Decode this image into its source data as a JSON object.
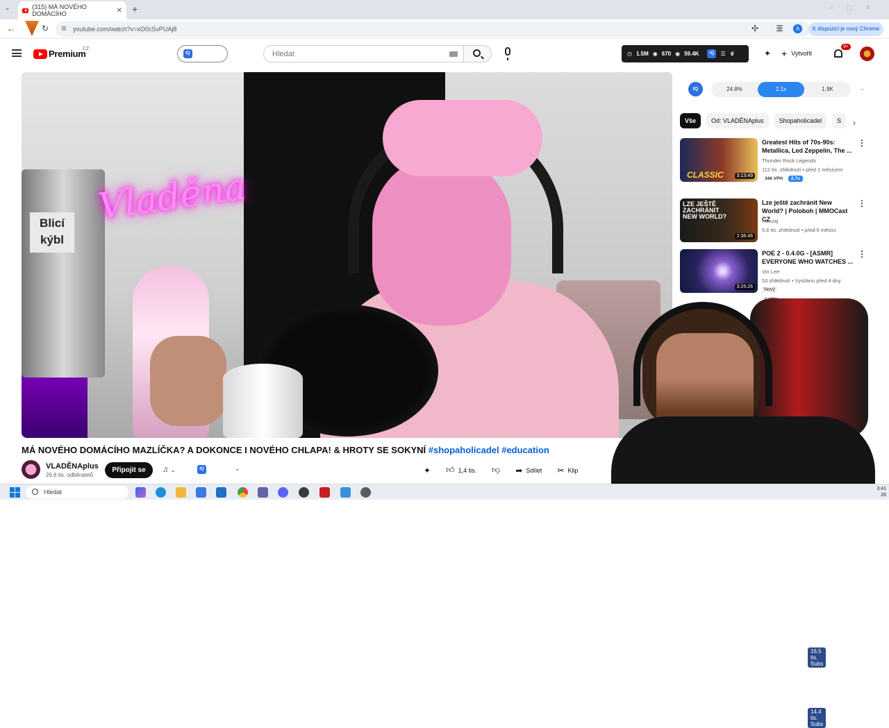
{
  "browser": {
    "tab_title": "(315) MÁ NOVÉHO DOMÁCÍHO",
    "tab_close": "✕",
    "new_tab": "+",
    "url": "youtube.com/watch?v=xO0cSvPUAj8",
    "chrome_notice": "K dispozici je nový Chrome",
    "profile_initial": "A"
  },
  "header": {
    "brand": "Premium",
    "region": "CZ",
    "search_placeholder": "Hledat",
    "stats": {
      "views": "1.5M",
      "viewers": "670",
      "likes": "59.4K",
      "iq": "IQ"
    },
    "create_label": "Vytvořit",
    "notifications": "9+"
  },
  "video": {
    "neon_text": "Vladěna",
    "bucket_text": "Blicí kýbl",
    "title_main": "MÁ NOVÉHO DOMÁCÍHO MAZLÍČKA? A DOKONCE I NOVÉHO CHLAPA! & HROTY SE SOKYNÍ ",
    "tags": "#shopaholicadel #education"
  },
  "channel": {
    "name": "VLADĚNAplus",
    "subscribers": "26,6 tis. odběratelů",
    "join_label": "Připojit se",
    "iq": "IQ"
  },
  "actions": {
    "likes": "1,4 tis.",
    "share": "Sdílet",
    "clip": "Klip"
  },
  "sidebar": {
    "iq": "IQ",
    "metrics": [
      "24.8%",
      "2.1x",
      "1.9K"
    ],
    "chips": [
      "Vše",
      "Od: VLADĚNAplus",
      "Shopaholicadel",
      "S"
    ],
    "recs": [
      {
        "title": "Greatest Hits of 70s-90s: Metallica, Led Zeppelin, The ...",
        "channel": "Thunder Rock Legends",
        "meta": "112 tis. zhlédnutí • před 1 měsícem",
        "duration": "3:13:49",
        "thumb_text": "CLASSIC",
        "vph": "346 VPH",
        "mult": "2.7x",
        "subs": "16,5 tis. Subs"
      },
      {
        "title": "Lze ještě zachránit New World? | Poloboh | MMOCast CZ",
        "channel": "Honzaj",
        "meta": "5,6 tis. zhlédnutí • před 6 měsíci",
        "duration": "2:36:46",
        "thumb_text": "LZE JEŠTĚ ZACHRÁNIT NEW WORLD?",
        "subs": "14,4 tis. Subs"
      },
      {
        "title": "POE 2 - 0.4.0G - [ASMR] EVERYONE WHO WATCHES ...",
        "channel": "Vin Lee",
        "meta": "53 zhlédnutí • Vysíláno před 4 dny",
        "duration": "3:25:26",
        "badge": "Nový",
        "vph": "1 VPH"
      }
    ]
  },
  "taskbar": {
    "search_placeholder": "Hledat",
    "time": "3:41",
    "date": "26"
  },
  "colors": {
    "youtube_red": "#ff0000",
    "link_blue": "#065fd4",
    "iq_blue": "#2f6fe4",
    "highlight_blue": "#2b86f0"
  }
}
